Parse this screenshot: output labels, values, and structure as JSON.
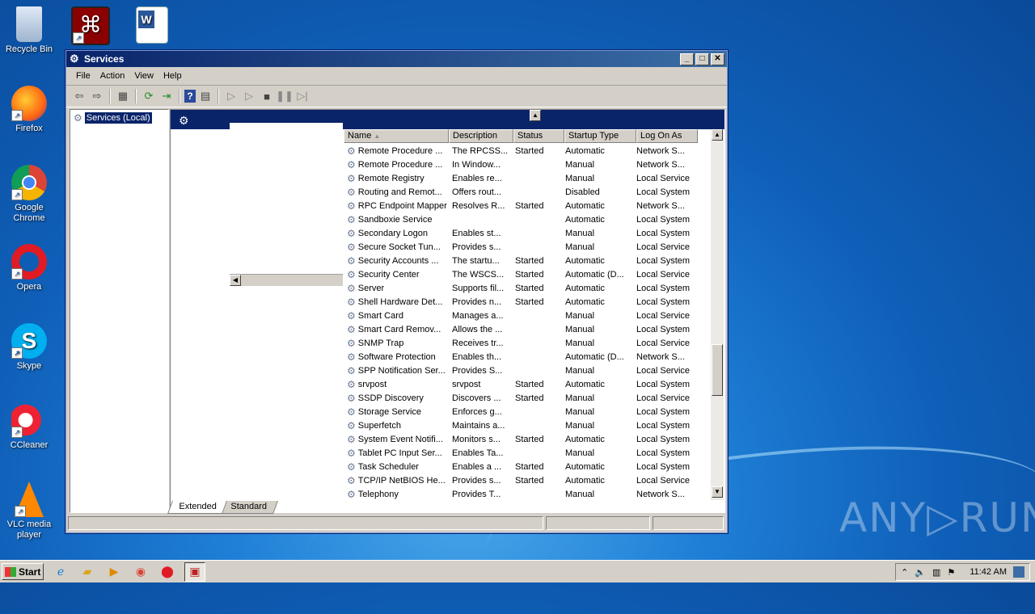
{
  "desktop": {
    "icons": [
      {
        "label": "Recycle Bin",
        "icon": "recycle-bin-icon"
      },
      {
        "label": "Firefox",
        "icon": "firefox-icon"
      },
      {
        "label": "Google Chrome",
        "icon": "chrome-icon"
      },
      {
        "label": "Opera",
        "icon": "opera-icon"
      },
      {
        "label": "Skype",
        "icon": "skype-icon"
      },
      {
        "label": "CCleaner",
        "icon": "ccleaner-icon"
      },
      {
        "label": "VLC media player",
        "icon": "vlc-icon"
      }
    ],
    "top_icons": [
      {
        "icon": "acrobat-icon"
      },
      {
        "icon": "word-document-icon"
      }
    ],
    "watermark": "ANY▷RUN"
  },
  "window": {
    "title": "Services",
    "menu": [
      "File",
      "Action",
      "View",
      "Help"
    ],
    "tree_root": "Services (Local)",
    "columns": [
      "Name",
      "Description",
      "Status",
      "Startup Type",
      "Log On As"
    ],
    "rows": [
      [
        "Remote Procedure ...",
        "The RPCSS...",
        "Started",
        "Automatic",
        "Network S..."
      ],
      [
        "Remote Procedure ...",
        "In Window...",
        "",
        "Manual",
        "Network S..."
      ],
      [
        "Remote Registry",
        "Enables re...",
        "",
        "Manual",
        "Local Service"
      ],
      [
        "Routing and Remot...",
        "Offers rout...",
        "",
        "Disabled",
        "Local System"
      ],
      [
        "RPC Endpoint Mapper",
        "Resolves R...",
        "Started",
        "Automatic",
        "Network S..."
      ],
      [
        "Sandboxie Service",
        "",
        "",
        "Automatic",
        "Local System"
      ],
      [
        "Secondary Logon",
        "Enables st...",
        "",
        "Manual",
        "Local System"
      ],
      [
        "Secure Socket Tun...",
        "Provides s...",
        "",
        "Manual",
        "Local Service"
      ],
      [
        "Security Accounts ...",
        "The startu...",
        "Started",
        "Automatic",
        "Local System"
      ],
      [
        "Security Center",
        "The WSCS...",
        "Started",
        "Automatic (D...",
        "Local Service"
      ],
      [
        "Server",
        "Supports fil...",
        "Started",
        "Automatic",
        "Local System"
      ],
      [
        "Shell Hardware Det...",
        "Provides n...",
        "Started",
        "Automatic",
        "Local System"
      ],
      [
        "Smart Card",
        "Manages a...",
        "",
        "Manual",
        "Local Service"
      ],
      [
        "Smart Card Remov...",
        "Allows the ...",
        "",
        "Manual",
        "Local System"
      ],
      [
        "SNMP Trap",
        "Receives tr...",
        "",
        "Manual",
        "Local Service"
      ],
      [
        "Software Protection",
        "Enables th...",
        "",
        "Automatic (D...",
        "Network S..."
      ],
      [
        "SPP Notification Ser...",
        "Provides S...",
        "",
        "Manual",
        "Local Service"
      ],
      [
        "srvpost",
        "srvpost",
        "Started",
        "Automatic",
        "Local System"
      ],
      [
        "SSDP Discovery",
        "Discovers ...",
        "Started",
        "Manual",
        "Local Service"
      ],
      [
        "Storage Service",
        "Enforces g...",
        "",
        "Manual",
        "Local System"
      ],
      [
        "Superfetch",
        "Maintains a...",
        "",
        "Manual",
        "Local System"
      ],
      [
        "System Event Notifi...",
        "Monitors s...",
        "Started",
        "Automatic",
        "Local System"
      ],
      [
        "Tablet PC Input Ser...",
        "Enables Ta...",
        "",
        "Manual",
        "Local System"
      ],
      [
        "Task Scheduler",
        "Enables a ...",
        "Started",
        "Automatic",
        "Local System"
      ],
      [
        "TCP/IP NetBIOS He...",
        "Provides s...",
        "Started",
        "Automatic",
        "Local Service"
      ],
      [
        "Telephony",
        "Provides T...",
        "",
        "Manual",
        "Network S..."
      ]
    ],
    "tabs": [
      "Extended",
      "Standard"
    ]
  },
  "taskbar": {
    "start_label": "Start",
    "clock": "11:42 AM"
  }
}
